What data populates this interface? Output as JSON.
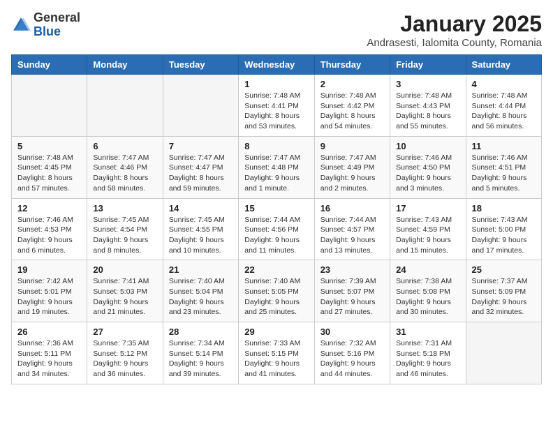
{
  "header": {
    "logo_general": "General",
    "logo_blue": "Blue",
    "title": "January 2025",
    "subtitle": "Andrasesti, Ialomita County, Romania"
  },
  "columns": [
    "Sunday",
    "Monday",
    "Tuesday",
    "Wednesday",
    "Thursday",
    "Friday",
    "Saturday"
  ],
  "weeks": [
    [
      {
        "day": "",
        "info": ""
      },
      {
        "day": "",
        "info": ""
      },
      {
        "day": "",
        "info": ""
      },
      {
        "day": "1",
        "info": "Sunrise: 7:48 AM\nSunset: 4:41 PM\nDaylight: 8 hours and 53 minutes."
      },
      {
        "day": "2",
        "info": "Sunrise: 7:48 AM\nSunset: 4:42 PM\nDaylight: 8 hours and 54 minutes."
      },
      {
        "day": "3",
        "info": "Sunrise: 7:48 AM\nSunset: 4:43 PM\nDaylight: 8 hours and 55 minutes."
      },
      {
        "day": "4",
        "info": "Sunrise: 7:48 AM\nSunset: 4:44 PM\nDaylight: 8 hours and 56 minutes."
      }
    ],
    [
      {
        "day": "5",
        "info": "Sunrise: 7:48 AM\nSunset: 4:45 PM\nDaylight: 8 hours and 57 minutes."
      },
      {
        "day": "6",
        "info": "Sunrise: 7:47 AM\nSunset: 4:46 PM\nDaylight: 8 hours and 58 minutes."
      },
      {
        "day": "7",
        "info": "Sunrise: 7:47 AM\nSunset: 4:47 PM\nDaylight: 8 hours and 59 minutes."
      },
      {
        "day": "8",
        "info": "Sunrise: 7:47 AM\nSunset: 4:48 PM\nDaylight: 9 hours and 1 minute."
      },
      {
        "day": "9",
        "info": "Sunrise: 7:47 AM\nSunset: 4:49 PM\nDaylight: 9 hours and 2 minutes."
      },
      {
        "day": "10",
        "info": "Sunrise: 7:46 AM\nSunset: 4:50 PM\nDaylight: 9 hours and 3 minutes."
      },
      {
        "day": "11",
        "info": "Sunrise: 7:46 AM\nSunset: 4:51 PM\nDaylight: 9 hours and 5 minutes."
      }
    ],
    [
      {
        "day": "12",
        "info": "Sunrise: 7:46 AM\nSunset: 4:53 PM\nDaylight: 9 hours and 6 minutes."
      },
      {
        "day": "13",
        "info": "Sunrise: 7:45 AM\nSunset: 4:54 PM\nDaylight: 9 hours and 8 minutes."
      },
      {
        "day": "14",
        "info": "Sunrise: 7:45 AM\nSunset: 4:55 PM\nDaylight: 9 hours and 10 minutes."
      },
      {
        "day": "15",
        "info": "Sunrise: 7:44 AM\nSunset: 4:56 PM\nDaylight: 9 hours and 11 minutes."
      },
      {
        "day": "16",
        "info": "Sunrise: 7:44 AM\nSunset: 4:57 PM\nDaylight: 9 hours and 13 minutes."
      },
      {
        "day": "17",
        "info": "Sunrise: 7:43 AM\nSunset: 4:59 PM\nDaylight: 9 hours and 15 minutes."
      },
      {
        "day": "18",
        "info": "Sunrise: 7:43 AM\nSunset: 5:00 PM\nDaylight: 9 hours and 17 minutes."
      }
    ],
    [
      {
        "day": "19",
        "info": "Sunrise: 7:42 AM\nSunset: 5:01 PM\nDaylight: 9 hours and 19 minutes."
      },
      {
        "day": "20",
        "info": "Sunrise: 7:41 AM\nSunset: 5:03 PM\nDaylight: 9 hours and 21 minutes."
      },
      {
        "day": "21",
        "info": "Sunrise: 7:40 AM\nSunset: 5:04 PM\nDaylight: 9 hours and 23 minutes."
      },
      {
        "day": "22",
        "info": "Sunrise: 7:40 AM\nSunset: 5:05 PM\nDaylight: 9 hours and 25 minutes."
      },
      {
        "day": "23",
        "info": "Sunrise: 7:39 AM\nSunset: 5:07 PM\nDaylight: 9 hours and 27 minutes."
      },
      {
        "day": "24",
        "info": "Sunrise: 7:38 AM\nSunset: 5:08 PM\nDaylight: 9 hours and 30 minutes."
      },
      {
        "day": "25",
        "info": "Sunrise: 7:37 AM\nSunset: 5:09 PM\nDaylight: 9 hours and 32 minutes."
      }
    ],
    [
      {
        "day": "26",
        "info": "Sunrise: 7:36 AM\nSunset: 5:11 PM\nDaylight: 9 hours and 34 minutes."
      },
      {
        "day": "27",
        "info": "Sunrise: 7:35 AM\nSunset: 5:12 PM\nDaylight: 9 hours and 36 minutes."
      },
      {
        "day": "28",
        "info": "Sunrise: 7:34 AM\nSunset: 5:14 PM\nDaylight: 9 hours and 39 minutes."
      },
      {
        "day": "29",
        "info": "Sunrise: 7:33 AM\nSunset: 5:15 PM\nDaylight: 9 hours and 41 minutes."
      },
      {
        "day": "30",
        "info": "Sunrise: 7:32 AM\nSunset: 5:16 PM\nDaylight: 9 hours and 44 minutes."
      },
      {
        "day": "31",
        "info": "Sunrise: 7:31 AM\nSunset: 5:18 PM\nDaylight: 9 hours and 46 minutes."
      },
      {
        "day": "",
        "info": ""
      }
    ]
  ]
}
